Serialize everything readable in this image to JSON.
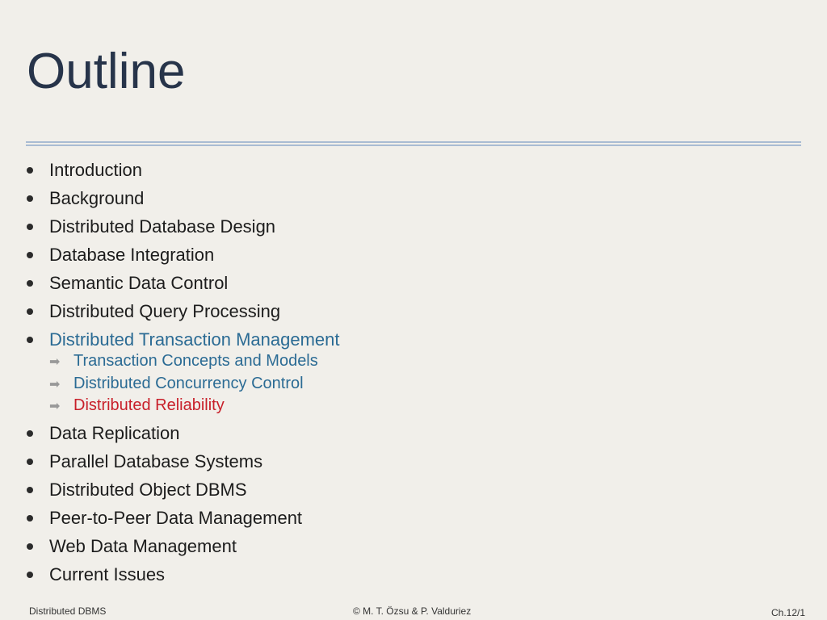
{
  "title": "Outline",
  "outline_top": [
    "Introduction",
    "Background",
    "Distributed Database Design",
    "Database Integration",
    "Semantic Data Control",
    "Distributed Query Processing",
    "Distributed Transaction Management"
  ],
  "sub_items": [
    "Transaction Concepts and Models",
    "Distributed Concurrency Control",
    "Distributed Reliability"
  ],
  "outline_bottom": [
    "Data Replication",
    "Parallel Database Systems",
    "Distributed Object DBMS",
    "Peer-to-Peer Data Management",
    "Web Data Management",
    "Current Issues"
  ],
  "footer": {
    "left": "Distributed DBMS",
    "center": "© M. T. Özsu & P. Valduriez",
    "right": "Ch.12/1"
  },
  "colors": {
    "title": "#27344a",
    "highlight": "#2b6b94",
    "current_subtopic": "#c8202a",
    "rule": "#a9bcd3"
  }
}
